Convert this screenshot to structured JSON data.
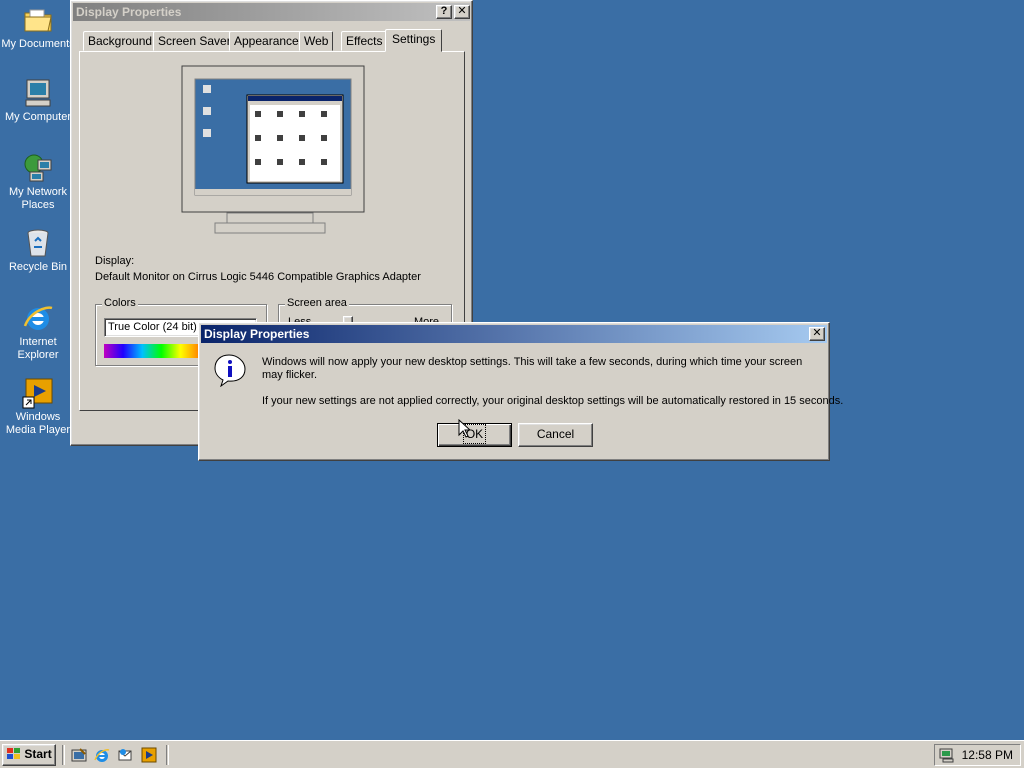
{
  "desktop": {
    "icons": [
      {
        "label": "My Documents"
      },
      {
        "label": "My Computer"
      },
      {
        "label": "My Network Places"
      },
      {
        "label": "Recycle Bin"
      },
      {
        "label": "Internet Explorer"
      },
      {
        "label": "Windows Media Player"
      }
    ]
  },
  "display_window": {
    "title": "Display Properties",
    "help_button": "?",
    "close_button": "✕",
    "tabs": [
      {
        "label": "Background"
      },
      {
        "label": "Screen Saver"
      },
      {
        "label": "Appearance"
      },
      {
        "label": "Web"
      },
      {
        "label": "Effects"
      },
      {
        "label": "Settings"
      }
    ],
    "selected_tab": "Settings",
    "display_label": "Display:",
    "display_value": "Default Monitor on Cirrus Logic 5446 Compatible Graphics Adapter",
    "colors_group": "Colors",
    "colors_value": "True Color (24 bit)",
    "screen_area_group": "Screen area",
    "screen_area_less": "Less",
    "screen_area_more": "More"
  },
  "dialog": {
    "title": "Display Properties",
    "close_button": "✕",
    "message1": "Windows will now apply your new desktop settings. This will take a few seconds, during which time your screen may flicker.",
    "message2": "If your new settings are not applied correctly, your original desktop settings will be automatically restored in 15 seconds.",
    "ok_label": "OK",
    "cancel_label": "Cancel"
  },
  "taskbar": {
    "start_label": "Start",
    "clock": "12:58 PM"
  },
  "colors": {
    "desktop": "#3a6ea5",
    "face": "#d4d0c8",
    "active_title": "#0a246a"
  }
}
